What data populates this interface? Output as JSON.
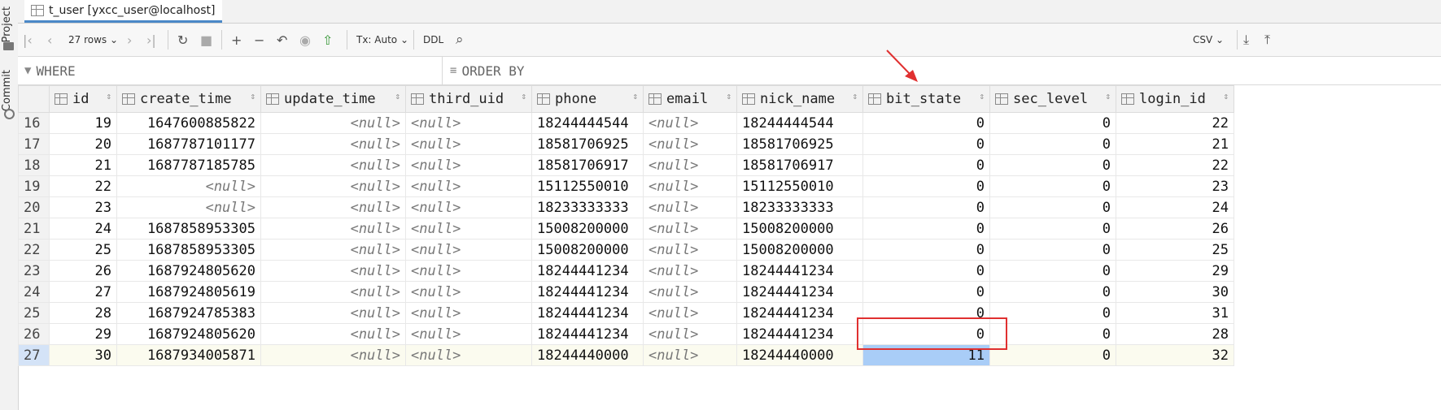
{
  "sidebar": {
    "project_label": "Project",
    "commit_label": "Commit"
  },
  "tab": {
    "title": "t_user [yxcc_user@localhost]"
  },
  "toolbar": {
    "rows_label": "27 rows",
    "tx_label": "Tx: Auto",
    "ddl_label": "DDL",
    "export_label": "CSV"
  },
  "filter": {
    "where_placeholder": "WHERE",
    "order_placeholder": "ORDER BY"
  },
  "columns": [
    "id",
    "create_time",
    "update_time",
    "third_uid",
    "phone",
    "email",
    "nick_name",
    "bit_state",
    "sec_level",
    "login_id"
  ],
  "null_text": "<null>",
  "rows": [
    {
      "n": "16",
      "id": "19",
      "create_time": "1647600885822",
      "update_time": "<null>",
      "third_uid": "<null>",
      "phone": "18244444544",
      "email": "<null>",
      "nick_name": "18244444544",
      "bit_state": "0",
      "sec_level": "0",
      "login_id": "22"
    },
    {
      "n": "17",
      "id": "20",
      "create_time": "1687787101177",
      "update_time": "<null>",
      "third_uid": "<null>",
      "phone": "18581706925",
      "email": "<null>",
      "nick_name": "18581706925",
      "bit_state": "0",
      "sec_level": "0",
      "login_id": "21"
    },
    {
      "n": "18",
      "id": "21",
      "create_time": "1687787185785",
      "update_time": "<null>",
      "third_uid": "<null>",
      "phone": "18581706917",
      "email": "<null>",
      "nick_name": "18581706917",
      "bit_state": "0",
      "sec_level": "0",
      "login_id": "22"
    },
    {
      "n": "19",
      "id": "22",
      "create_time": "<null>",
      "update_time": "<null>",
      "third_uid": "<null>",
      "phone": "15112550010",
      "email": "<null>",
      "nick_name": "15112550010",
      "bit_state": "0",
      "sec_level": "0",
      "login_id": "23"
    },
    {
      "n": "20",
      "id": "23",
      "create_time": "<null>",
      "update_time": "<null>",
      "third_uid": "<null>",
      "phone": "18233333333",
      "email": "<null>",
      "nick_name": "18233333333",
      "bit_state": "0",
      "sec_level": "0",
      "login_id": "24"
    },
    {
      "n": "21",
      "id": "24",
      "create_time": "1687858953305",
      "update_time": "<null>",
      "third_uid": "<null>",
      "phone": "15008200000",
      "email": "<null>",
      "nick_name": "15008200000",
      "bit_state": "0",
      "sec_level": "0",
      "login_id": "26"
    },
    {
      "n": "22",
      "id": "25",
      "create_time": "1687858953305",
      "update_time": "<null>",
      "third_uid": "<null>",
      "phone": "15008200000",
      "email": "<null>",
      "nick_name": "15008200000",
      "bit_state": "0",
      "sec_level": "0",
      "login_id": "25"
    },
    {
      "n": "23",
      "id": "26",
      "create_time": "1687924805620",
      "update_time": "<null>",
      "third_uid": "<null>",
      "phone": "18244441234",
      "email": "<null>",
      "nick_name": "18244441234",
      "bit_state": "0",
      "sec_level": "0",
      "login_id": "29"
    },
    {
      "n": "24",
      "id": "27",
      "create_time": "1687924805619",
      "update_time": "<null>",
      "third_uid": "<null>",
      "phone": "18244441234",
      "email": "<null>",
      "nick_name": "18244441234",
      "bit_state": "0",
      "sec_level": "0",
      "login_id": "30"
    },
    {
      "n": "25",
      "id": "28",
      "create_time": "1687924785383",
      "update_time": "<null>",
      "third_uid": "<null>",
      "phone": "18244441234",
      "email": "<null>",
      "nick_name": "18244441234",
      "bit_state": "0",
      "sec_level": "0",
      "login_id": "31"
    },
    {
      "n": "26",
      "id": "29",
      "create_time": "1687924805620",
      "update_time": "<null>",
      "third_uid": "<null>",
      "phone": "18244441234",
      "email": "<null>",
      "nick_name": "18244441234",
      "bit_state": "0",
      "sec_level": "0",
      "login_id": "28"
    },
    {
      "n": "27",
      "id": "30",
      "create_time": "1687934005871",
      "update_time": "<null>",
      "third_uid": "<null>",
      "phone": "18244440000",
      "email": "<null>",
      "nick_name": "18244440000",
      "bit_state": "11",
      "sec_level": "0",
      "login_id": "32"
    }
  ],
  "selected_row": "27",
  "colors": {
    "accent": "#4a88c7",
    "annotation_red": "#e03030",
    "selected_cell": "#a9cdf7"
  }
}
